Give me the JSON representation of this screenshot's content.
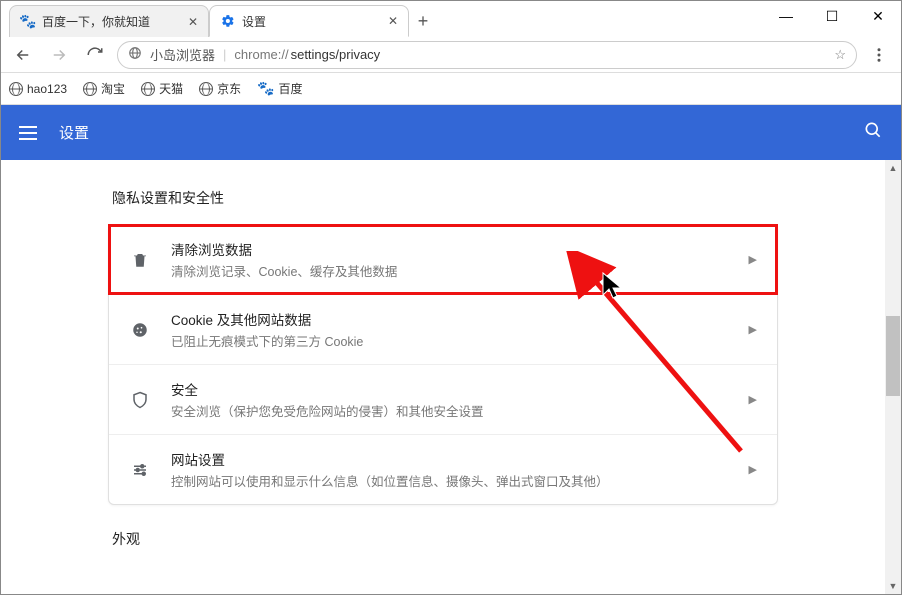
{
  "window": {
    "tabs": [
      {
        "title": "百度一下，你就知道",
        "favicon": "paw",
        "active": false
      },
      {
        "title": "设置",
        "favicon": "gear",
        "active": true
      }
    ],
    "controls": {
      "minimize": "—",
      "maximize": "☐",
      "close": "✕"
    }
  },
  "toolbar": {
    "secure_label": "小岛浏览器",
    "url_host": "chrome://",
    "url_path": "settings/privacy"
  },
  "bookmarks": [
    {
      "icon": "globe",
      "label": "hao123"
    },
    {
      "icon": "globe",
      "label": "淘宝"
    },
    {
      "icon": "globe",
      "label": "天猫"
    },
    {
      "icon": "globe",
      "label": "京东"
    },
    {
      "icon": "paw",
      "label": "百度"
    }
  ],
  "header": {
    "title": "设置"
  },
  "section": {
    "title": "隐私设置和安全性",
    "rows": [
      {
        "icon": "trash",
        "title": "清除浏览数据",
        "sub": "清除浏览记录、Cookie、缓存及其他数据"
      },
      {
        "icon": "cookie",
        "title": "Cookie 及其他网站数据",
        "sub": "已阻止无痕模式下的第三方 Cookie"
      },
      {
        "icon": "shield",
        "title": "安全",
        "sub": "安全浏览（保护您免受危险网站的侵害）和其他安全设置"
      },
      {
        "icon": "sliders",
        "title": "网站设置",
        "sub": "控制网站可以使用和显示什么信息（如位置信息、摄像头、弹出式窗口及其他）"
      }
    ],
    "next_section_title": "外观"
  }
}
